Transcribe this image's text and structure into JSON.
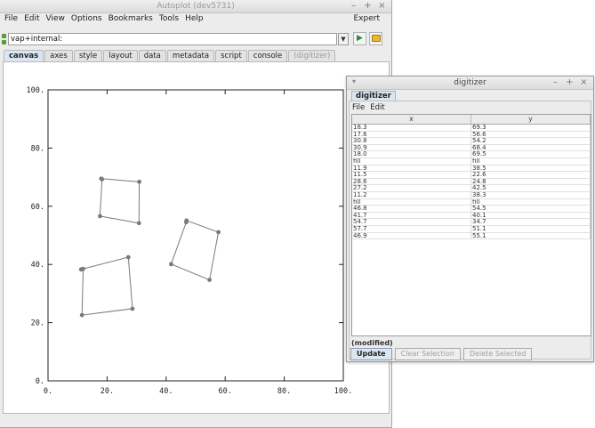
{
  "main_window": {
    "title": "Autoplot (dev5731)",
    "menu": [
      "File",
      "Edit",
      "View",
      "Options",
      "Bookmarks",
      "Tools",
      "Help"
    ],
    "expert_label": "Expert",
    "address": "vap+internal:",
    "tabs": [
      "canvas",
      "axes",
      "style",
      "layout",
      "data",
      "metadata",
      "script",
      "console",
      "(digitizer)"
    ],
    "active_tab": "canvas"
  },
  "chart_data": {
    "type": "scatter",
    "title": "",
    "xlabel": "",
    "ylabel": "",
    "xlim": [
      0,
      100
    ],
    "ylim": [
      0,
      100
    ],
    "x_ticks": [
      "0.",
      "20.",
      "40.",
      "60.",
      "80.",
      "100."
    ],
    "y_ticks": [
      "0.",
      "20.",
      "40.",
      "60.",
      "80.",
      "100."
    ],
    "grid": false,
    "series": [
      {
        "points": [
          [
            18.3,
            69.3
          ],
          [
            17.6,
            56.6
          ],
          [
            30.8,
            54.2
          ],
          [
            30.9,
            68.4
          ],
          [
            18.0,
            69.5
          ]
        ]
      },
      {
        "points": [
          [
            11.9,
            38.5
          ],
          [
            11.5,
            22.6
          ],
          [
            28.6,
            24.8
          ],
          [
            27.2,
            42.5
          ],
          [
            11.2,
            38.3
          ]
        ]
      },
      {
        "points": [
          [
            46.8,
            54.5
          ],
          [
            41.7,
            40.1
          ],
          [
            54.7,
            34.7
          ],
          [
            57.7,
            51.1
          ],
          [
            46.9,
            55.1
          ]
        ]
      }
    ],
    "marker_color": "#7a7a7a",
    "line_color": "#7a7a7a"
  },
  "digitizer": {
    "title": "digitizer",
    "tab": "digitizer",
    "menu": [
      "File",
      "Edit"
    ],
    "columns": [
      "x",
      "y"
    ],
    "rows": [
      [
        "18.3",
        "69.3"
      ],
      [
        "17.6",
        "56.6"
      ],
      [
        "30.8",
        "54.2"
      ],
      [
        "30.9",
        "68.4"
      ],
      [
        "18.0",
        "69.5"
      ],
      [
        "fill",
        "fill"
      ],
      [
        "11.9",
        "38.5"
      ],
      [
        "11.5",
        "22.6"
      ],
      [
        "28.6",
        "24.8"
      ],
      [
        "27.2",
        "42.5"
      ],
      [
        "11.2",
        "38.3"
      ],
      [
        "fill",
        "fill"
      ],
      [
        "46.8",
        "54.5"
      ],
      [
        "41.7",
        "40.1"
      ],
      [
        "54.7",
        "34.7"
      ],
      [
        "57.7",
        "51.1"
      ],
      [
        "46.9",
        "55.1"
      ]
    ],
    "status": "(modified)",
    "buttons": [
      "Update",
      "Clear Selection",
      "Delete Selected"
    ]
  }
}
